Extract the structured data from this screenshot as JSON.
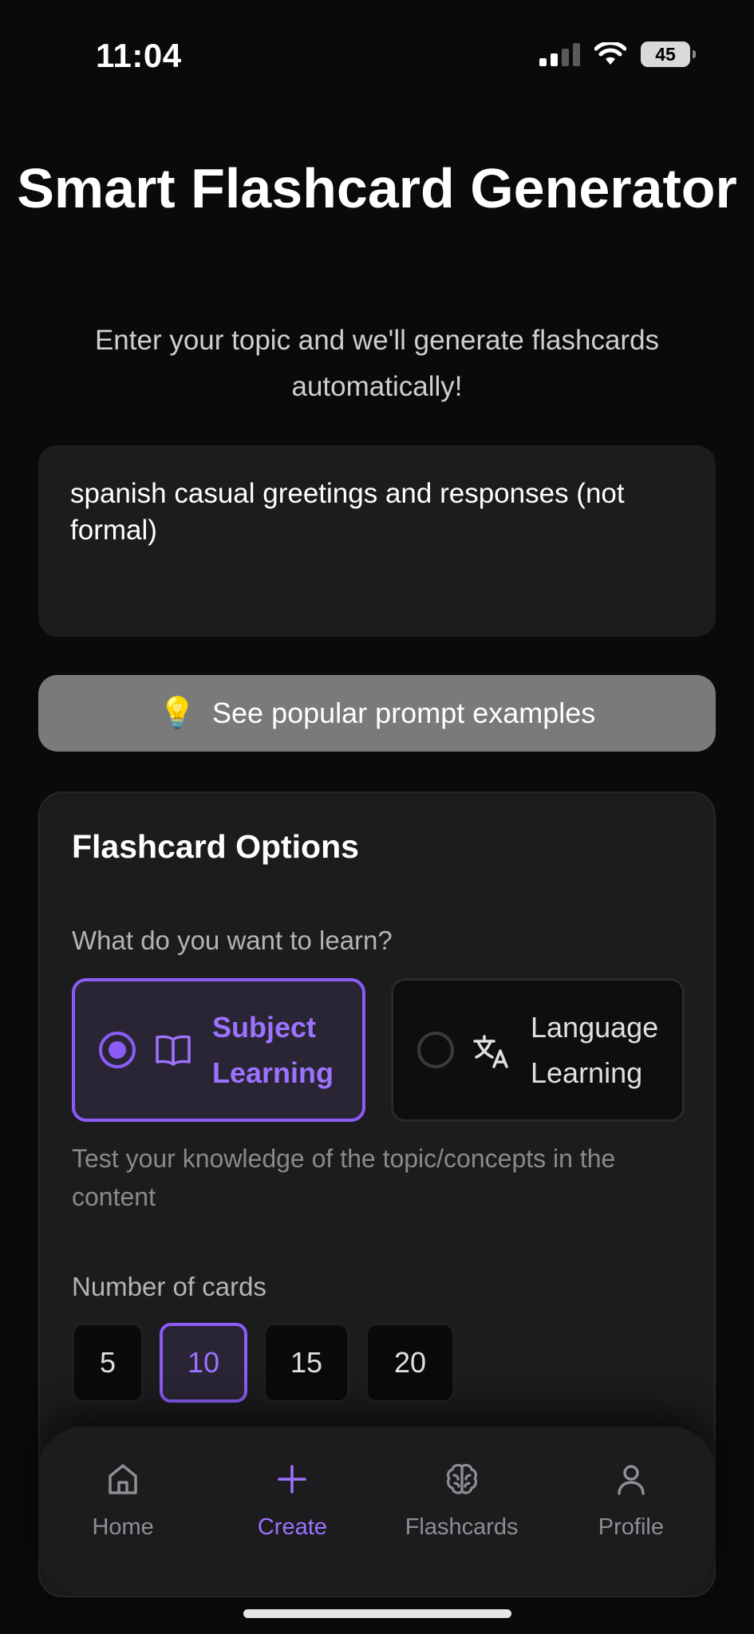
{
  "status_bar": {
    "time": "11:04",
    "battery": "45"
  },
  "header": {
    "title": "Smart Flashcard Generator",
    "subtitle": "Enter your topic and we'll generate flashcards automatically!"
  },
  "topic_input": {
    "value": "spanish casual greetings and responses (not formal)"
  },
  "examples_button": {
    "icon": "lightbulb-icon",
    "label": "See popular prompt examples"
  },
  "options": {
    "title": "Flashcard Options",
    "question": "What do you want to learn?",
    "modes": [
      {
        "label": "Subject Learning",
        "icon": "book-icon",
        "selected": true
      },
      {
        "label": "Language Learning",
        "icon": "translate-icon",
        "selected": false
      }
    ],
    "mode_description": "Test your knowledge of the topic/concepts in the content",
    "count_label": "Number of cards",
    "counts": [
      "5",
      "10",
      "15",
      "20"
    ],
    "selected_count": "10"
  },
  "nav": {
    "items": [
      {
        "label": "Home",
        "icon": "home-icon"
      },
      {
        "label": "Create",
        "icon": "plus-icon",
        "active": true
      },
      {
        "label": "Flashcards",
        "icon": "brain-icon"
      },
      {
        "label": "Profile",
        "icon": "user-icon"
      }
    ]
  },
  "colors": {
    "accent": "#8b5cf6",
    "accent_text": "#9d72ff",
    "background": "#0a0a0a",
    "card": "#1c1c1e"
  }
}
